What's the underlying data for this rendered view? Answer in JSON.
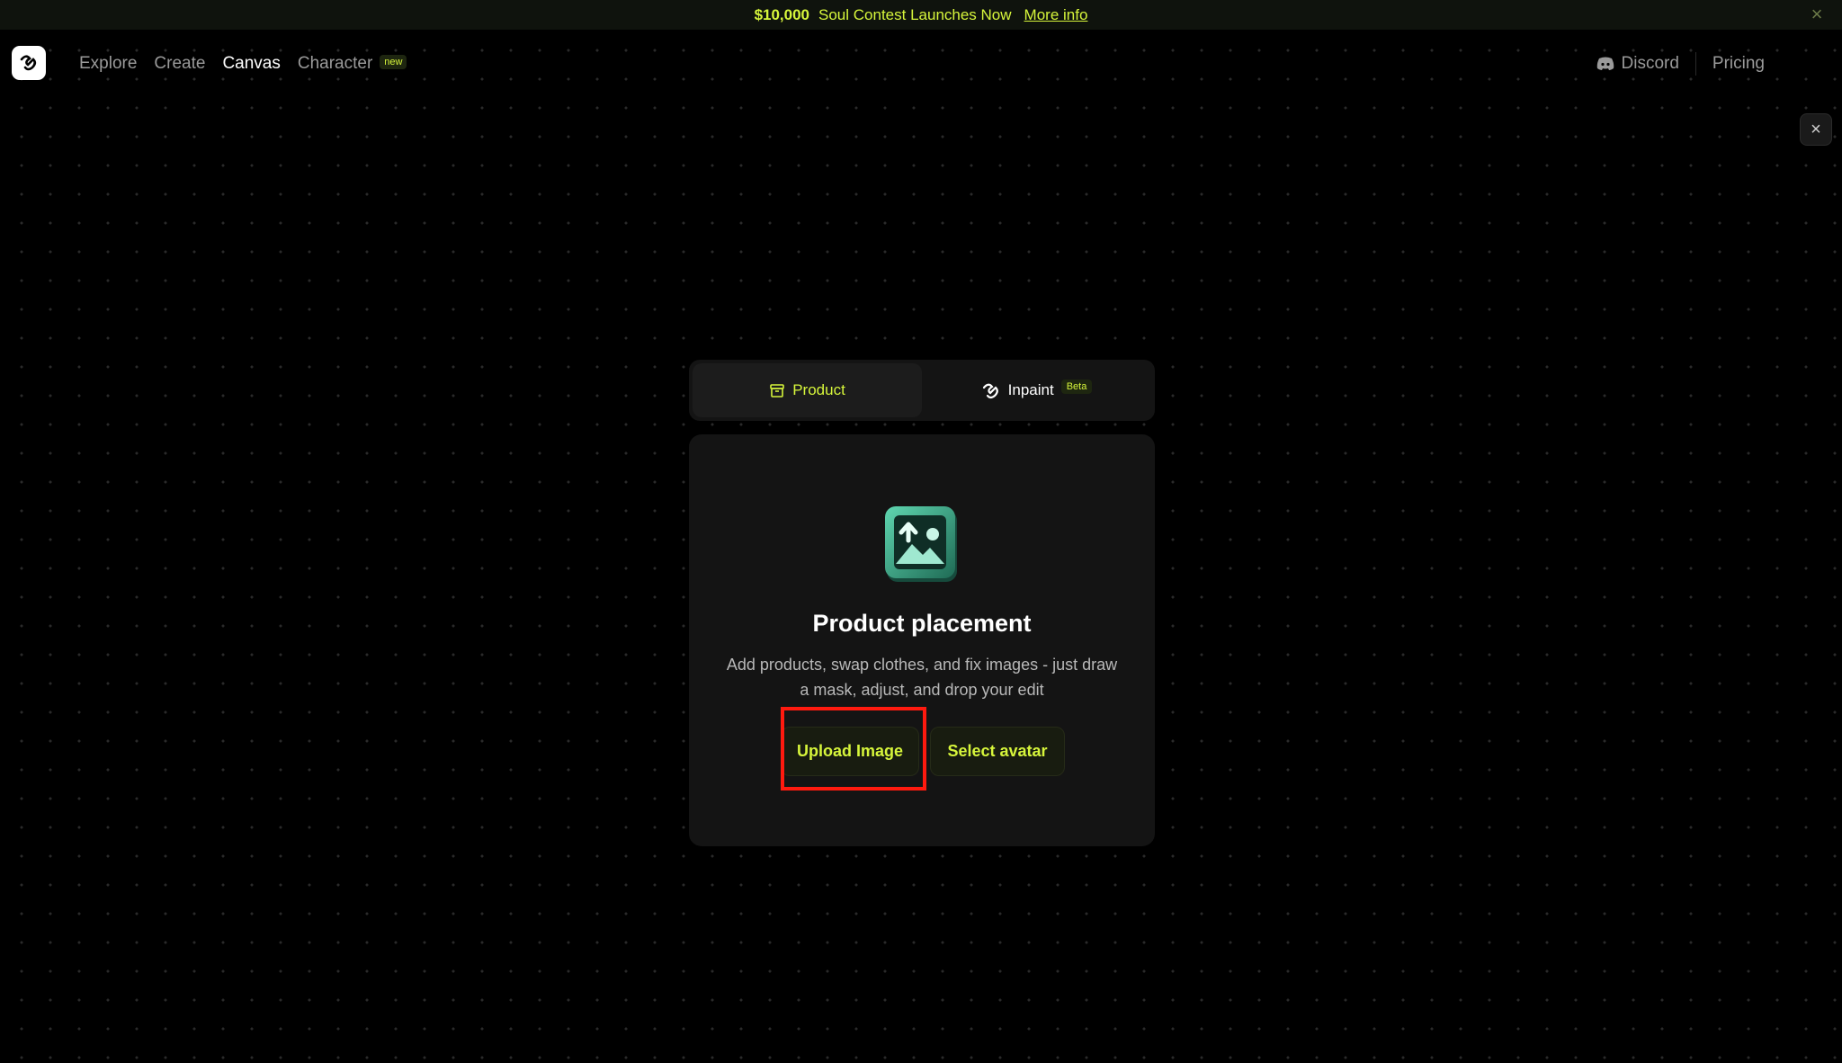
{
  "banner": {
    "amount": "$10,000",
    "message": "Soul Contest Launches Now",
    "link": "More info",
    "close_icon": "close-icon"
  },
  "nav": {
    "logo_icon": "brand-logo-icon",
    "links": [
      {
        "label": "Explore",
        "active": false
      },
      {
        "label": "Create",
        "active": false
      },
      {
        "label": "Canvas",
        "active": true
      },
      {
        "label": "Character",
        "active": false,
        "badge": "new"
      }
    ],
    "discord": "Discord",
    "pricing": "Pricing"
  },
  "tabs": [
    {
      "label": "Product",
      "icon": "box-icon",
      "active": true
    },
    {
      "label": "Inpaint",
      "icon": "brand-swirl-icon",
      "active": false,
      "badge": "Beta"
    }
  ],
  "card": {
    "icon": "image-upload-icon",
    "title": "Product placement",
    "description": "Add products, swap clothes, and fix images - just draw a mask, adjust, and drop your edit",
    "primary_button": "Upload Image",
    "secondary_button": "Select avatar"
  },
  "colors": {
    "accent": "#d6f53b",
    "highlight": "#ff1a0f",
    "background": "#000000",
    "card": "#141414"
  }
}
